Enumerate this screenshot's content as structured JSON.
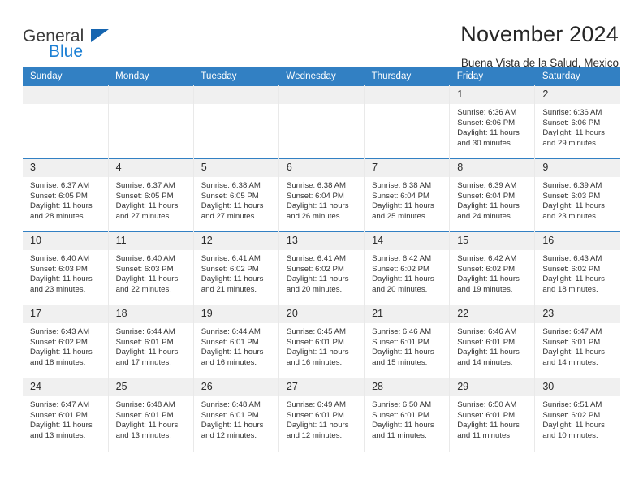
{
  "brand": {
    "line1": "General",
    "line2": "Blue",
    "triangle_color": "#1565b0",
    "blue_color": "#1b7fd4"
  },
  "header": {
    "title": "November 2024",
    "subtitle": "Buena Vista de la Salud, Mexico"
  },
  "theme": {
    "header_bg": "#3280c3",
    "daynum_bg": "#f0f0f0",
    "row_border": "#3280c3",
    "cell_border": "#e9e9e9"
  },
  "weekday_headers": [
    "Sunday",
    "Monday",
    "Tuesday",
    "Wednesday",
    "Thursday",
    "Friday",
    "Saturday"
  ],
  "weeks": [
    [
      {
        "day": "",
        "lines": []
      },
      {
        "day": "",
        "lines": []
      },
      {
        "day": "",
        "lines": []
      },
      {
        "day": "",
        "lines": []
      },
      {
        "day": "",
        "lines": []
      },
      {
        "day": "1",
        "lines": [
          "Sunrise: 6:36 AM",
          "Sunset: 6:06 PM",
          "Daylight: 11 hours and 30 minutes."
        ]
      },
      {
        "day": "2",
        "lines": [
          "Sunrise: 6:36 AM",
          "Sunset: 6:06 PM",
          "Daylight: 11 hours and 29 minutes."
        ]
      }
    ],
    [
      {
        "day": "3",
        "lines": [
          "Sunrise: 6:37 AM",
          "Sunset: 6:05 PM",
          "Daylight: 11 hours and 28 minutes."
        ]
      },
      {
        "day": "4",
        "lines": [
          "Sunrise: 6:37 AM",
          "Sunset: 6:05 PM",
          "Daylight: 11 hours and 27 minutes."
        ]
      },
      {
        "day": "5",
        "lines": [
          "Sunrise: 6:38 AM",
          "Sunset: 6:05 PM",
          "Daylight: 11 hours and 27 minutes."
        ]
      },
      {
        "day": "6",
        "lines": [
          "Sunrise: 6:38 AM",
          "Sunset: 6:04 PM",
          "Daylight: 11 hours and 26 minutes."
        ]
      },
      {
        "day": "7",
        "lines": [
          "Sunrise: 6:38 AM",
          "Sunset: 6:04 PM",
          "Daylight: 11 hours and 25 minutes."
        ]
      },
      {
        "day": "8",
        "lines": [
          "Sunrise: 6:39 AM",
          "Sunset: 6:04 PM",
          "Daylight: 11 hours and 24 minutes."
        ]
      },
      {
        "day": "9",
        "lines": [
          "Sunrise: 6:39 AM",
          "Sunset: 6:03 PM",
          "Daylight: 11 hours and 23 minutes."
        ]
      }
    ],
    [
      {
        "day": "10",
        "lines": [
          "Sunrise: 6:40 AM",
          "Sunset: 6:03 PM",
          "Daylight: 11 hours and 23 minutes."
        ]
      },
      {
        "day": "11",
        "lines": [
          "Sunrise: 6:40 AM",
          "Sunset: 6:03 PM",
          "Daylight: 11 hours and 22 minutes."
        ]
      },
      {
        "day": "12",
        "lines": [
          "Sunrise: 6:41 AM",
          "Sunset: 6:02 PM",
          "Daylight: 11 hours and 21 minutes."
        ]
      },
      {
        "day": "13",
        "lines": [
          "Sunrise: 6:41 AM",
          "Sunset: 6:02 PM",
          "Daylight: 11 hours and 20 minutes."
        ]
      },
      {
        "day": "14",
        "lines": [
          "Sunrise: 6:42 AM",
          "Sunset: 6:02 PM",
          "Daylight: 11 hours and 20 minutes."
        ]
      },
      {
        "day": "15",
        "lines": [
          "Sunrise: 6:42 AM",
          "Sunset: 6:02 PM",
          "Daylight: 11 hours and 19 minutes."
        ]
      },
      {
        "day": "16",
        "lines": [
          "Sunrise: 6:43 AM",
          "Sunset: 6:02 PM",
          "Daylight: 11 hours and 18 minutes."
        ]
      }
    ],
    [
      {
        "day": "17",
        "lines": [
          "Sunrise: 6:43 AM",
          "Sunset: 6:02 PM",
          "Daylight: 11 hours and 18 minutes."
        ]
      },
      {
        "day": "18",
        "lines": [
          "Sunrise: 6:44 AM",
          "Sunset: 6:01 PM",
          "Daylight: 11 hours and 17 minutes."
        ]
      },
      {
        "day": "19",
        "lines": [
          "Sunrise: 6:44 AM",
          "Sunset: 6:01 PM",
          "Daylight: 11 hours and 16 minutes."
        ]
      },
      {
        "day": "20",
        "lines": [
          "Sunrise: 6:45 AM",
          "Sunset: 6:01 PM",
          "Daylight: 11 hours and 16 minutes."
        ]
      },
      {
        "day": "21",
        "lines": [
          "Sunrise: 6:46 AM",
          "Sunset: 6:01 PM",
          "Daylight: 11 hours and 15 minutes."
        ]
      },
      {
        "day": "22",
        "lines": [
          "Sunrise: 6:46 AM",
          "Sunset: 6:01 PM",
          "Daylight: 11 hours and 14 minutes."
        ]
      },
      {
        "day": "23",
        "lines": [
          "Sunrise: 6:47 AM",
          "Sunset: 6:01 PM",
          "Daylight: 11 hours and 14 minutes."
        ]
      }
    ],
    [
      {
        "day": "24",
        "lines": [
          "Sunrise: 6:47 AM",
          "Sunset: 6:01 PM",
          "Daylight: 11 hours and 13 minutes."
        ]
      },
      {
        "day": "25",
        "lines": [
          "Sunrise: 6:48 AM",
          "Sunset: 6:01 PM",
          "Daylight: 11 hours and 13 minutes."
        ]
      },
      {
        "day": "26",
        "lines": [
          "Sunrise: 6:48 AM",
          "Sunset: 6:01 PM",
          "Daylight: 11 hours and 12 minutes."
        ]
      },
      {
        "day": "27",
        "lines": [
          "Sunrise: 6:49 AM",
          "Sunset: 6:01 PM",
          "Daylight: 11 hours and 12 minutes."
        ]
      },
      {
        "day": "28",
        "lines": [
          "Sunrise: 6:50 AM",
          "Sunset: 6:01 PM",
          "Daylight: 11 hours and 11 minutes."
        ]
      },
      {
        "day": "29",
        "lines": [
          "Sunrise: 6:50 AM",
          "Sunset: 6:01 PM",
          "Daylight: 11 hours and 11 minutes."
        ]
      },
      {
        "day": "30",
        "lines": [
          "Sunrise: 6:51 AM",
          "Sunset: 6:02 PM",
          "Daylight: 11 hours and 10 minutes."
        ]
      }
    ]
  ]
}
